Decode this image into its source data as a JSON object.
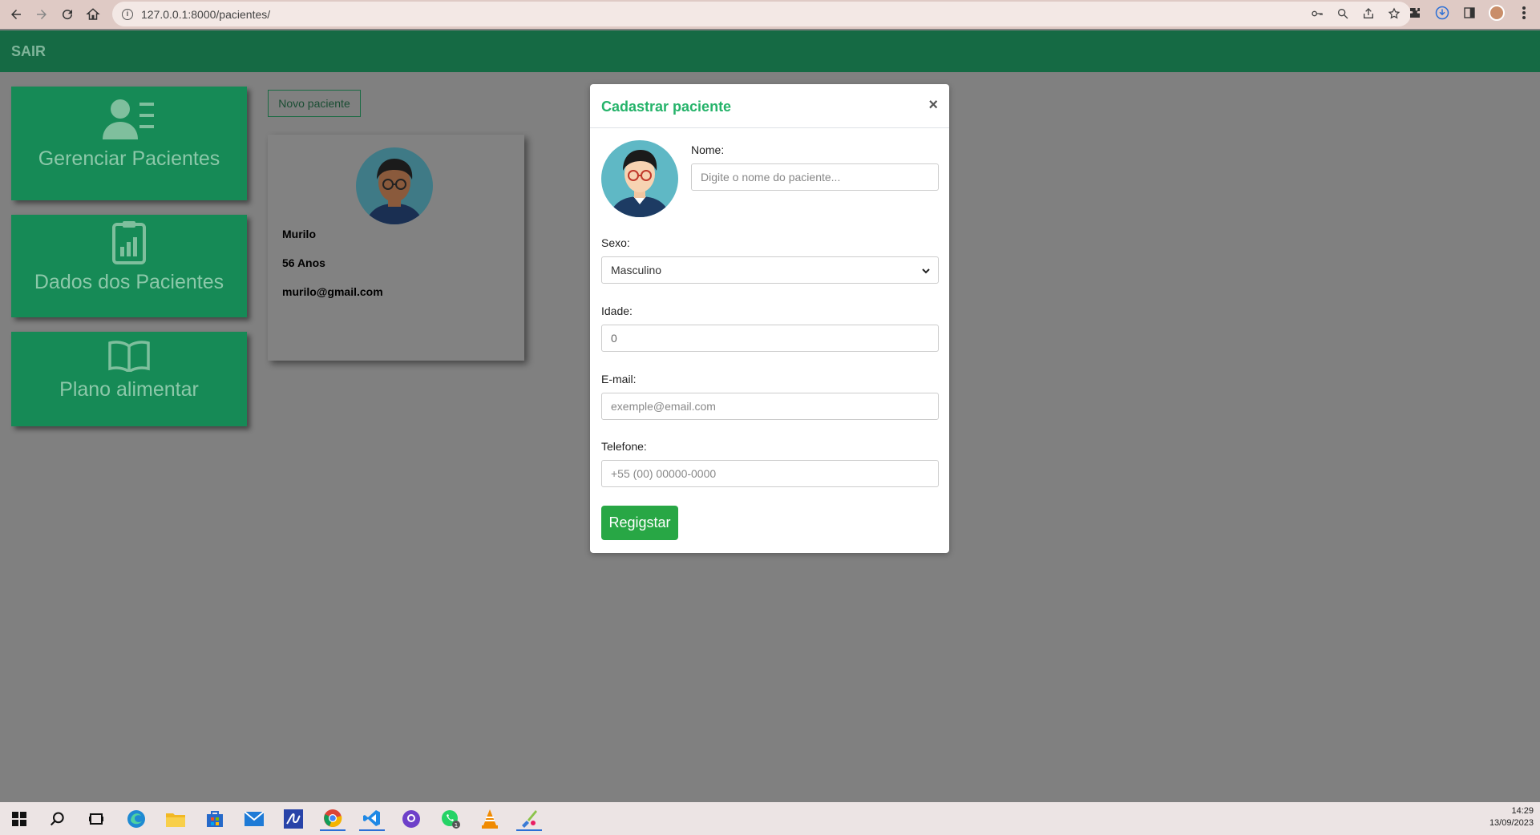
{
  "browser": {
    "url": "127.0.0.1:8000/pacientes/"
  },
  "header": {
    "logout_label": "SAIR"
  },
  "sidebar": {
    "items": [
      {
        "label": "Gerenciar Pacientes",
        "icon": "user-list-icon"
      },
      {
        "label": "Dados dos Pacientes",
        "icon": "clipboard-chart-icon"
      },
      {
        "label": "Plano alimentar",
        "icon": "book-icon"
      }
    ]
  },
  "main": {
    "new_patient_label": "Novo paciente",
    "patients": [
      {
        "name": "Murilo",
        "age": "56 Anos",
        "email": "murilo@gmail.com"
      }
    ]
  },
  "modal": {
    "title": "Cadastrar paciente",
    "close": "×",
    "name_label": "Nome:",
    "name_placeholder": "Digite o nome do paciente...",
    "sex_label": "Sexo:",
    "sex_value": "Masculino",
    "age_label": "Idade:",
    "age_value": "0",
    "email_label": "E-mail:",
    "email_placeholder": "exemple@email.com",
    "phone_label": "Telefone:",
    "phone_placeholder": "+55 (00) 00000-0000",
    "submit_label": "Regigstar"
  },
  "taskbar": {
    "time": "14:29",
    "date": "13/09/2023"
  },
  "colors": {
    "brand": "#168a56",
    "topbar": "#156a44",
    "accent_title": "#25b36a",
    "submit": "#28a745"
  }
}
